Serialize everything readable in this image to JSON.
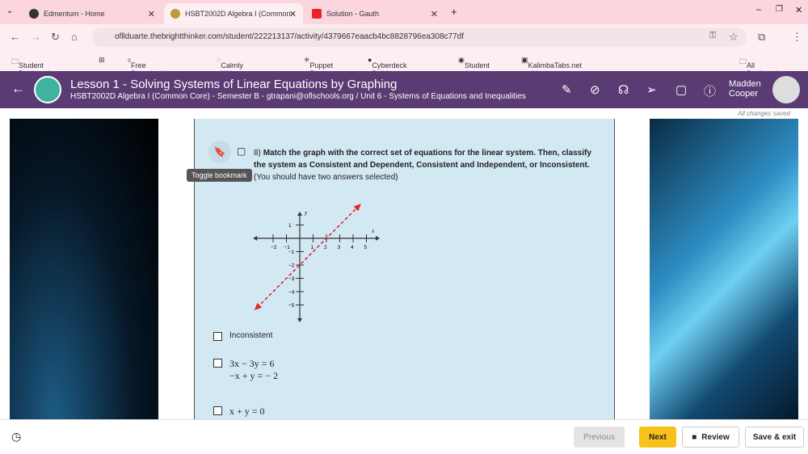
{
  "browser": {
    "tabs": [
      {
        "title": "Edmentum - Home"
      },
      {
        "title": "HSBT2002D Algebra I (Common"
      },
      {
        "title": "Solution - Gauth"
      }
    ],
    "url": "ofllduarte.thebrightthinker.com/student/222213137/activity/4379667eaacb4bc8828796ea308c77df",
    "bookmarks": [
      "Student Bookmarks",
      "Free Paraphrasing...",
      "Calmly Writer Online",
      "Puppet Pets",
      "Cyberdeck Build Gui...",
      "Student App",
      "KalimbaTabs.net - Y..."
    ],
    "all_bookmarks": "All Bookmarks"
  },
  "header": {
    "title": "Lesson 1 - Solving Systems of Linear Equations by Graphing",
    "subtitle": "HSBT2002D Algebra I (Common Core) - Semester B - gtrapani@oflschools.org / Unit 6 - Systems of Equations and Inequalities",
    "user_first": "Madden",
    "user_last": "Cooper",
    "saved": "All changes saved",
    "accent": "#5a3b73"
  },
  "question": {
    "number": "8)",
    "bold": "Match the graph with the correct set of equations for the linear system. Then, classify the system as Consistent and Dependent, Consistent and Independent, or Inconsistent.",
    "rest": " (You should have two answers selected)",
    "tooltip": "Toggle bookmark"
  },
  "graph": {
    "x_label": "x",
    "y_label": "y",
    "x_ticks": [
      "−2",
      "−1",
      "1",
      "2",
      "3",
      "4",
      "5"
    ],
    "y_ticks": [
      "1",
      "−1",
      "−2",
      "−3",
      "−4",
      "−5"
    ],
    "line": {
      "points": [
        [
          2,
          0
        ],
        [
          0,
          -2
        ]
      ],
      "style": "dashed",
      "color": "#e8232a"
    }
  },
  "options": [
    {
      "label": "Inconsistent"
    },
    {
      "line1": "3x − 3y = 6",
      "line2": "−x + y = − 2"
    },
    {
      "line1": "x + y = 0"
    }
  ],
  "footer": {
    "previous": "Previous",
    "next": "Next",
    "review": "Review",
    "save_exit": "Save & exit"
  }
}
